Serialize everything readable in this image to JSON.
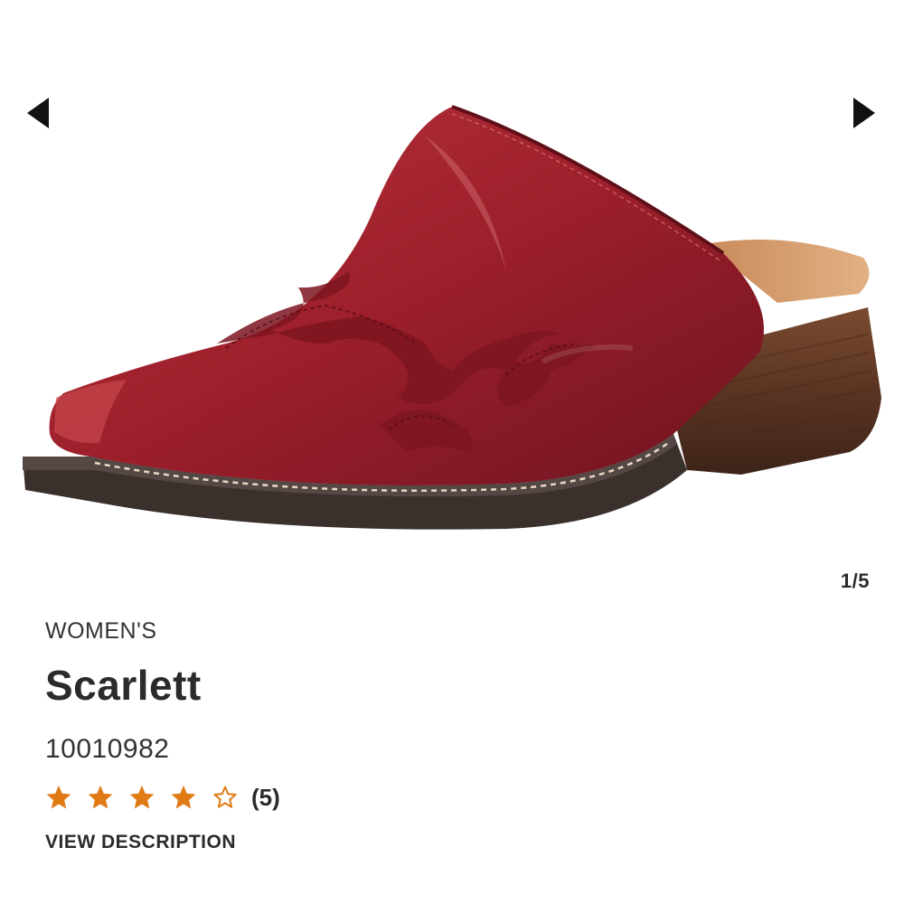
{
  "carousel": {
    "image_alt": "Scarlett red leather western mule",
    "prev_icon": "triangle-left-icon",
    "next_icon": "triangle-right-icon",
    "current": 1,
    "total": 5,
    "counter_text": "1/5"
  },
  "product": {
    "gender": "WOMEN'S",
    "name": "Scarlett",
    "sku": "10010982",
    "rating": {
      "value": 4,
      "max": 5,
      "count_text": "(5)",
      "filled_icon": "star-filled-icon",
      "empty_icon": "star-outline-icon",
      "star_color": "#e07a14"
    },
    "view_description_label": "VIEW DESCRIPTION"
  }
}
